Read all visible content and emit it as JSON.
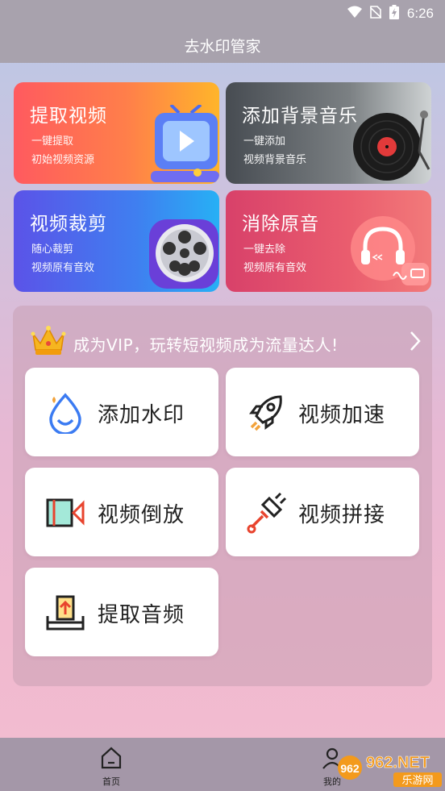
{
  "status_bar": {
    "time": "6:26"
  },
  "app_bar": {
    "title": "去水印管家"
  },
  "cards": [
    {
      "title": "提取视频",
      "line1": "一键提取",
      "line2": "初始视频资源",
      "icon": "tv-play-icon"
    },
    {
      "title": "添加背景音乐",
      "line1": "一键添加",
      "line2": "视频背景音乐",
      "icon": "vinyl-record-icon"
    },
    {
      "title": "视频裁剪",
      "line1": "随心裁剪",
      "line2": "视频原有音效",
      "icon": "film-reel-icon"
    },
    {
      "title": "消除原音",
      "line1": "一键去除",
      "line2": "视频原有音效",
      "icon": "headphones-icon"
    }
  ],
  "vip": {
    "text": "成为VIP，玩转短视频成为流量达人!"
  },
  "tools": [
    {
      "label": "添加水印",
      "icon": "water-drop-icon"
    },
    {
      "label": "视频加速",
      "icon": "rocket-icon"
    },
    {
      "label": "视频倒放",
      "icon": "video-reverse-icon"
    },
    {
      "label": "视频拼接",
      "icon": "plug-connect-icon"
    },
    {
      "label": "提取音频",
      "icon": "extract-audio-icon"
    }
  ],
  "nav": [
    {
      "label": "首页",
      "icon": "home-icon"
    },
    {
      "label": "我的",
      "icon": "user-icon"
    }
  ],
  "watermark": {
    "text": "962.NET",
    "sub": "乐游网"
  }
}
